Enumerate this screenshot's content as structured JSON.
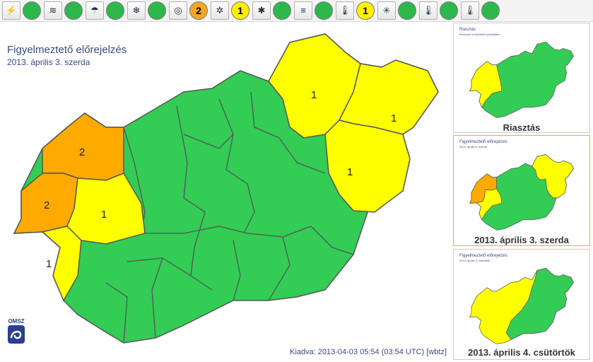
{
  "toolbar": {
    "items": [
      {
        "icon": "lightning-icon",
        "glyph": "⚡",
        "level": "",
        "color": "#2db84b"
      },
      {
        "icon": "wind-icon",
        "glyph": "≋",
        "level": "",
        "color": "#2db84b"
      },
      {
        "icon": "rain-icon",
        "glyph": "☂",
        "level": "",
        "color": "#2db84b"
      },
      {
        "icon": "freezing-rain-icon",
        "glyph": "❄",
        "level": "",
        "color": "#2db84b"
      },
      {
        "icon": "gust-icon",
        "glyph": "◎",
        "level": "2",
        "color": "#f5a623"
      },
      {
        "icon": "snow-drift-icon",
        "glyph": "✲",
        "level": "1",
        "color": "#ffee00"
      },
      {
        "icon": "snowfall-icon",
        "glyph": "✱",
        "level": "",
        "color": "#2db84b"
      },
      {
        "icon": "fog-icon",
        "glyph": "≡",
        "level": "",
        "color": "#2db84b"
      },
      {
        "icon": "low-temperature-icon",
        "glyph": "🌡",
        "level": "1",
        "color": "#ffee00"
      },
      {
        "icon": "frost-icon",
        "glyph": "✳",
        "level": "",
        "color": "#2db84b"
      },
      {
        "icon": "high-temperature-icon",
        "glyph": "🌡",
        "level": "",
        "color": "#2db84b"
      },
      {
        "icon": "heat-icon",
        "glyph": "🌡",
        "level": "",
        "color": "#2db84b"
      }
    ]
  },
  "main": {
    "title": "Figyelmeztető előrejelzés",
    "date": "2013. április 3. szerda",
    "issued": "Kiadva: 2013-04-03 05:54 (03:54 UTC) [wbtz]",
    "logo_text": "OMSZ",
    "colors": {
      "level0": "#33cc55",
      "level1": "#ffff00",
      "level2": "#ffaa00",
      "border": "#555555"
    },
    "regions": [
      {
        "id": "nw-2a",
        "level": "2",
        "label": "2"
      },
      {
        "id": "w-2b",
        "level": "2",
        "label": "2"
      },
      {
        "id": "w-1a",
        "level": "1",
        "label": "1"
      },
      {
        "id": "sw-1",
        "level": "1",
        "label": "1"
      },
      {
        "id": "ne-1a",
        "level": "1",
        "label": "1"
      },
      {
        "id": "ne-1b",
        "level": "1",
        "label": "1"
      },
      {
        "id": "e-1",
        "level": "1",
        "label": "1"
      }
    ]
  },
  "thumbnails": [
    {
      "caption": "Riasztás",
      "title": "Riasztás",
      "sub": "Érvényes a kiadástól kezdődően",
      "selected": false
    },
    {
      "caption": "2013. április 3. szerda",
      "title": "Figyelmeztető előrejelzés",
      "sub": "2013. április 3. szerda",
      "selected": true
    },
    {
      "caption": "2013. április 4. csütörtök",
      "title": "Figyelmeztető előrejelzés",
      "sub": "2013. április 4. csütörtök",
      "selected": false
    }
  ]
}
